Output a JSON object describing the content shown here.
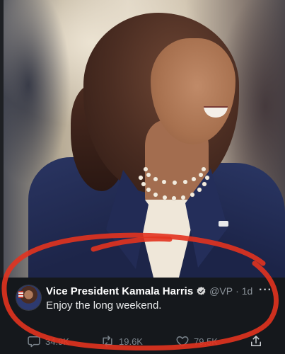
{
  "tweet": {
    "display_name": "Vice President Kamala Harris",
    "handle": "@VP",
    "separator": "·",
    "time": "1d",
    "text": "Enjoy the long weekend.",
    "more_label": "···",
    "avatar_icon": "avatar",
    "verified_icon": "verified-badge-icon"
  },
  "actions": {
    "replies": "34.9K",
    "retweets": "19.6K",
    "likes": "79.5K",
    "reply_icon": "reply-icon",
    "retweet_icon": "retweet-icon",
    "like_icon": "heart-icon",
    "share_icon": "share-icon"
  },
  "colors": {
    "background": "#15181c",
    "name_text": "#ffffff",
    "secondary_text": "#8b9299",
    "annotation_red": "#e2331f",
    "jacket_navy": "#1f2850"
  }
}
